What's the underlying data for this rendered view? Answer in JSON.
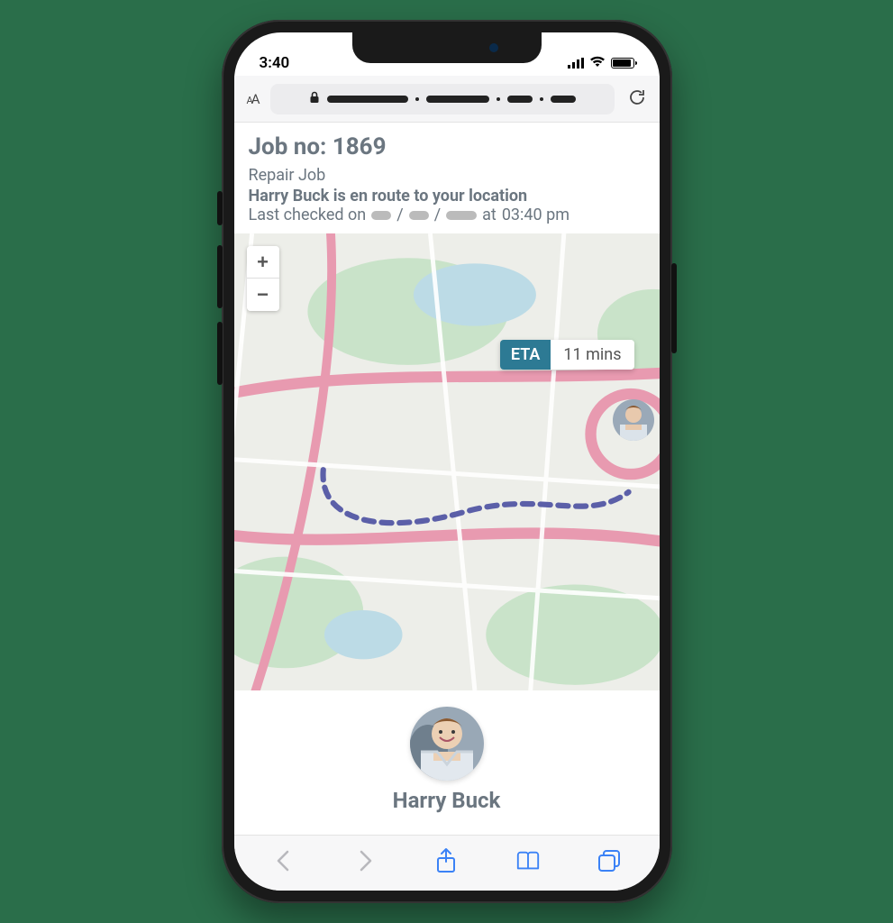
{
  "status": {
    "time": "3:40"
  },
  "browser": {
    "aa": "AA"
  },
  "job": {
    "job_no_label": "Job no:",
    "job_no": "1869",
    "type": "Repair Job",
    "enroute_prefix": "Harry Buck",
    "enroute_suffix": "is en route to your location",
    "checked_prefix": "Last checked on",
    "checked_time_prefix": "at",
    "checked_time": "03:40 pm"
  },
  "map": {
    "zoom_in": "+",
    "zoom_out": "−",
    "eta_label": "ETA",
    "eta_value": "11 mins"
  },
  "technician": {
    "name": "Harry Buck"
  }
}
